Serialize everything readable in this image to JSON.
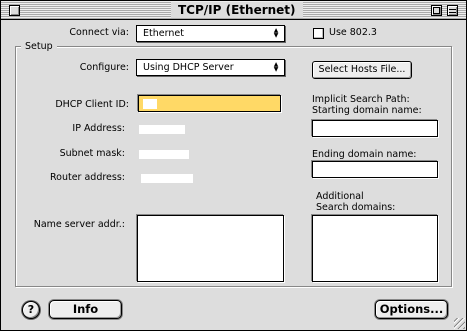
{
  "window": {
    "title": "TCP/IP (Ethernet)"
  },
  "connect": {
    "label": "Connect via:",
    "value": "Ethernet",
    "use8023_label": "Use 802.3",
    "use8023_checked": false
  },
  "setup": {
    "group_label": "Setup",
    "configure_label": "Configure:",
    "configure_value": "Using DHCP Server",
    "select_hosts_button": "Select Hosts File...",
    "dhcp_client_id_label": "DHCP Client ID:",
    "ip_address_label": "IP Address:",
    "subnet_mask_label": "Subnet mask:",
    "router_address_label": "Router address:",
    "name_server_label": "Name server addr.:",
    "implicit_search_label": "Implicit Search Path:",
    "starting_domain_label": "Starting domain name:",
    "ending_domain_label": "Ending domain name:",
    "additional_domains_label_1": "Additional",
    "additional_domains_label_2": "Search domains:"
  },
  "footer": {
    "help_label": "?",
    "info_button": "Info",
    "options_button": "Options..."
  },
  "colors": {
    "dhcp_field_highlight": "#ffd966",
    "window_bg": "#dddddd"
  }
}
